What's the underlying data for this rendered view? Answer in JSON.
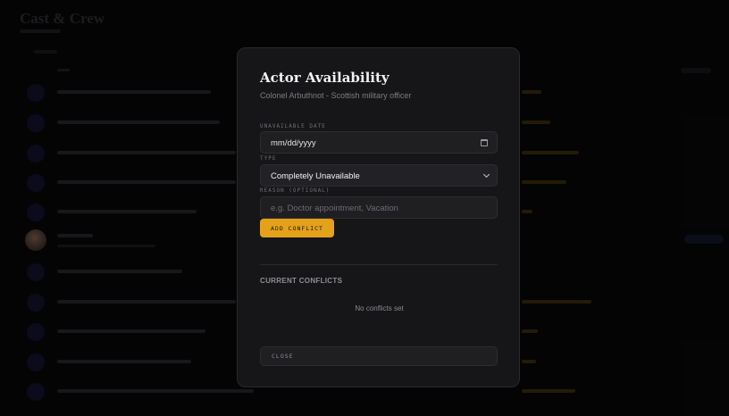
{
  "background_page": {
    "title": "Cast & Crew"
  },
  "modal": {
    "title": "Actor Availability",
    "subtitle": "Colonel Arbuthnot - Scottish military officer",
    "date_label": "UNAVAILABLE DATE",
    "date_placeholder": "mm/dd/yyyy",
    "type_label": "TYPE",
    "type_value": "Completely Unavailable",
    "reason_label": "REASON (OPTIONAL)",
    "reason_placeholder": "e.g. Doctor appointment, Vacation",
    "add_button": "ADD CONFLICT",
    "conflicts_title": "CURRENT CONFLICTS",
    "empty_state": "No conflicts set",
    "close_button": "CLOSE"
  },
  "icons": {
    "date": "calendar-icon",
    "type": "chevron-down-icon"
  },
  "colors": {
    "accent": "#e3a21a",
    "modal_bg": "#161618",
    "page_bg": "#070708"
  }
}
